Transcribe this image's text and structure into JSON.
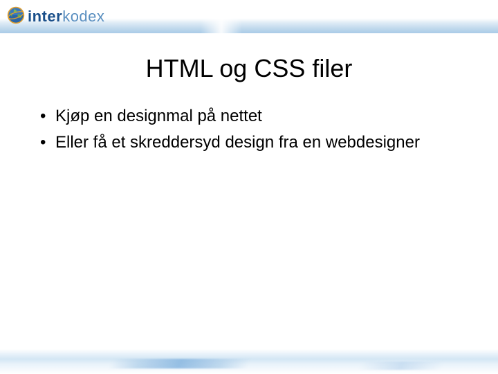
{
  "brand": {
    "part1": "inter",
    "part2": "kodex"
  },
  "title": "HTML og CSS filer",
  "bullets": [
    "Kjøp en designmal på nettet",
    "Eller få et skreddersyd design fra en webdesigner"
  ]
}
